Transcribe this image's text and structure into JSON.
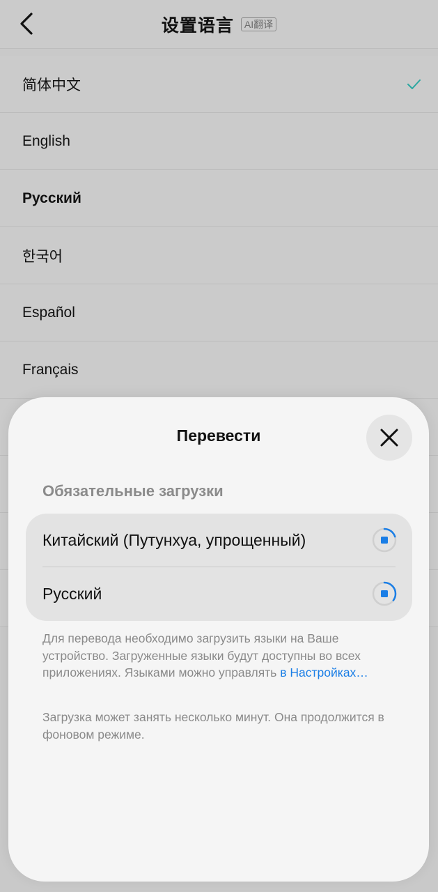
{
  "header": {
    "title": "设置语言",
    "ai_badge": "AI翻译"
  },
  "languages": [
    {
      "label": "简体中文",
      "selected": true
    },
    {
      "label": "English",
      "selected": false
    },
    {
      "label": "Русский",
      "selected": false
    },
    {
      "label": "한국어",
      "selected": false
    },
    {
      "label": "Español",
      "selected": false
    },
    {
      "label": "Français",
      "selected": false
    }
  ],
  "sheet": {
    "title": "Перевести",
    "section_label": "Обязательные загрузки",
    "downloads": [
      {
        "label": "Китайский (Путунхуа, упрощенный)",
        "progress": 0.2
      },
      {
        "label": "Русский",
        "progress": 0.35
      }
    ],
    "description_text": "Для перевода необходимо загрузить языки на Ваше устройство. Загруженные языки будут доступны во всех приложениях. Языками можно управлять",
    "settings_link": "в Настройках…",
    "note": "Загрузка может занять несколько минут. Она продолжится в фоновом режиме."
  },
  "colors": {
    "accent": "#1a7ee6",
    "check": "#2aa7a0",
    "sheet_bg": "#f5f5f5",
    "card_bg": "#e3e3e3"
  },
  "icons": {
    "back": "chevron-left-icon",
    "check": "checkmark-icon",
    "close": "close-icon",
    "progress": "download-progress-icon"
  }
}
